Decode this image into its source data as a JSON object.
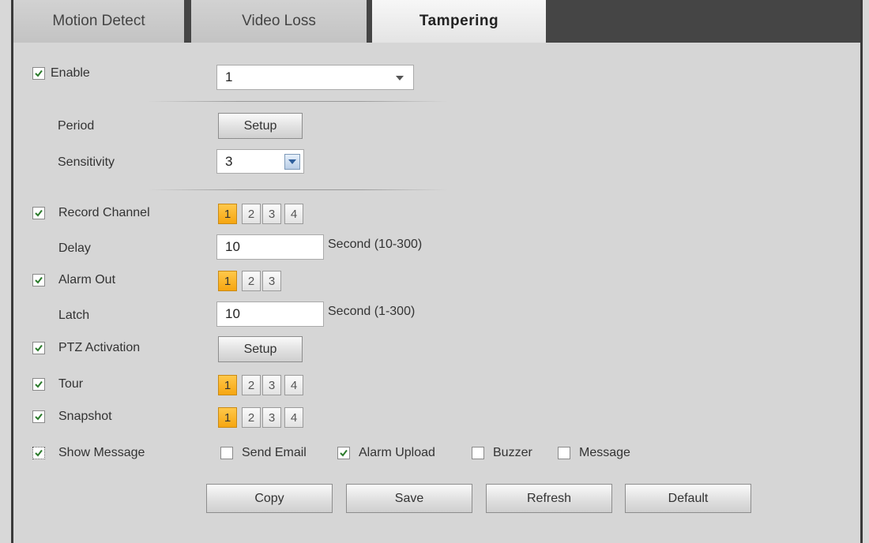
{
  "tabs": [
    {
      "label": "Motion Detect"
    },
    {
      "label": "Video Loss"
    },
    {
      "label": "Tampering",
      "active": true
    }
  ],
  "enable": {
    "label": "Enable",
    "checked": true,
    "channel_value": "1"
  },
  "period": {
    "label": "Period",
    "button": "Setup"
  },
  "sensitivity": {
    "label": "Sensitivity",
    "value": "3"
  },
  "record_channel": {
    "label": "Record Channel",
    "checked": true,
    "options": [
      "1",
      "2",
      "3",
      "4"
    ],
    "selected": "1"
  },
  "delay": {
    "label": "Delay",
    "value": "10",
    "unit": "Second (10-300)"
  },
  "alarm_out": {
    "label": "Alarm Out",
    "checked": true,
    "options": [
      "1",
      "2",
      "3"
    ],
    "selected": "1"
  },
  "latch": {
    "label": "Latch",
    "value": "10",
    "unit": "Second (1-300)"
  },
  "ptz": {
    "label": "PTZ Activation",
    "checked": true,
    "button": "Setup"
  },
  "tour": {
    "label": "Tour",
    "checked": true,
    "options": [
      "1",
      "2",
      "3",
      "4"
    ],
    "selected": "1"
  },
  "snapshot": {
    "label": "Snapshot",
    "checked": true,
    "options": [
      "1",
      "2",
      "3",
      "4"
    ],
    "selected": "1"
  },
  "show_message": {
    "label": "Show Message",
    "checked": true,
    "options": [
      {
        "label": "Send Email",
        "checked": false
      },
      {
        "label": "Alarm Upload",
        "checked": true
      },
      {
        "label": "Buzzer",
        "checked": false
      },
      {
        "label": "Message",
        "checked": false
      }
    ]
  },
  "actions": {
    "copy": "Copy",
    "save": "Save",
    "refresh": "Refresh",
    "default": "Default"
  },
  "colors": {
    "selected_number": "#f6a611",
    "tab_bar": "#454545",
    "panel": "#d6d6d6"
  }
}
